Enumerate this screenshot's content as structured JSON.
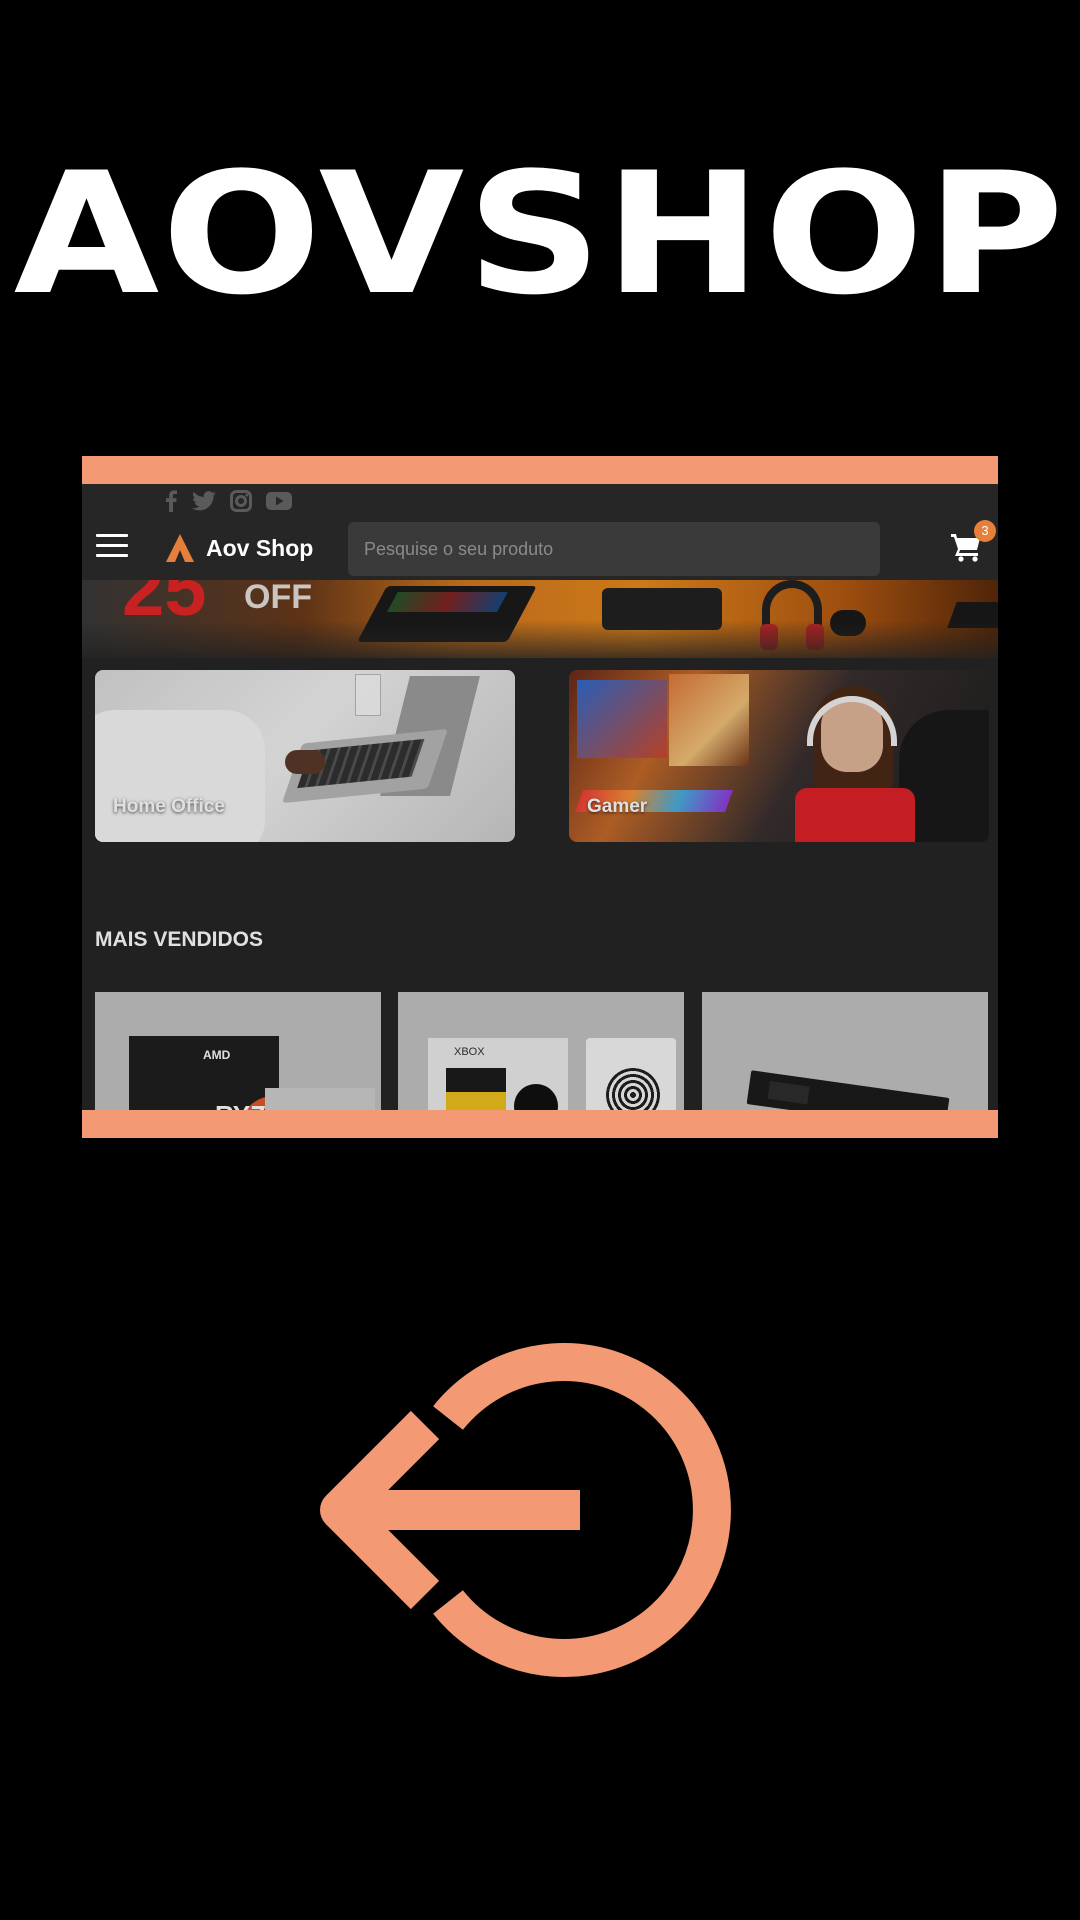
{
  "brand": {
    "title": "AOVSHOP"
  },
  "preview": {
    "social_icons": [
      "facebook-icon",
      "twitter-icon",
      "instagram-icon",
      "youtube-icon"
    ],
    "header": {
      "menu_icon": "hamburger-icon",
      "logo_text": "Aov Shop",
      "search_placeholder": "Pesquise o seu produto",
      "cart_icon": "cart-icon",
      "cart_count": "3"
    },
    "banner": {
      "discount_number": "25",
      "discount_suffix": "OFF"
    },
    "categories": [
      {
        "label": "Home Office"
      },
      {
        "label": "Gamer"
      }
    ],
    "best_sellers": {
      "title": "MAIS VENDIDOS",
      "products": [
        {
          "brand": "AMD",
          "product_text": "RYZ"
        },
        {
          "brand": "XBOX",
          "product_text": ""
        },
        {
          "brand": "",
          "product_text": ""
        }
      ]
    }
  },
  "actions": {
    "exit_icon": "logout-icon"
  },
  "colors": {
    "accent": "#f39a74",
    "background": "#000000",
    "app_background": "#262626",
    "search_background": "#3a3a3a",
    "badge": "#e57f3a",
    "text": "#ffffff"
  }
}
